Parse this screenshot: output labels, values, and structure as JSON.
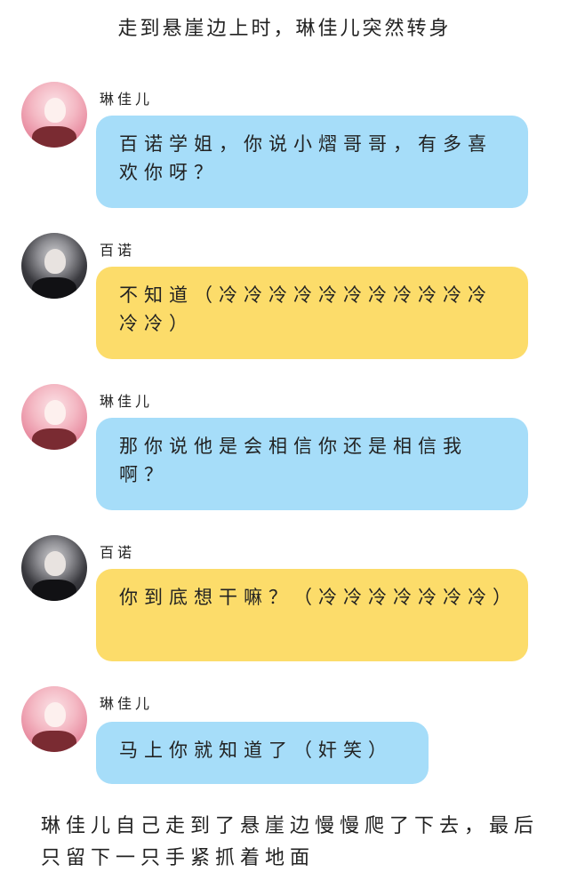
{
  "narration_top": "走到悬崖边上时，琳佳儿突然转身",
  "messages": [
    {
      "speaker": "琳佳儿",
      "avatar": "pink-hair-girl",
      "color": "#a6ddf9",
      "text": "百诺学姐，你说小熠哥哥，有多喜欢你呀？"
    },
    {
      "speaker": "百诺",
      "avatar": "dark-hair-girl",
      "color": "#fcdc6a",
      "text": "不知道（冷冷冷冷冷冷冷冷冷冷冷冷冷）"
    },
    {
      "speaker": "琳佳儿",
      "avatar": "pink-hair-girl",
      "color": "#a6ddf9",
      "text": "那你说他是会相信你还是相信我啊？"
    },
    {
      "speaker": "百诺",
      "avatar": "dark-hair-girl",
      "color": "#fcdc6a",
      "text": "你到底想干嘛？（冷冷冷冷冷冷冷）"
    },
    {
      "speaker": "琳佳儿",
      "avatar": "pink-hair-girl",
      "color": "#a6ddf9",
      "text": "马上你就知道了（奸笑）"
    }
  ],
  "narration_bottom": "琳佳儿自己走到了悬崖边慢慢爬了下去，最后只留下一只手紧抓着地面"
}
